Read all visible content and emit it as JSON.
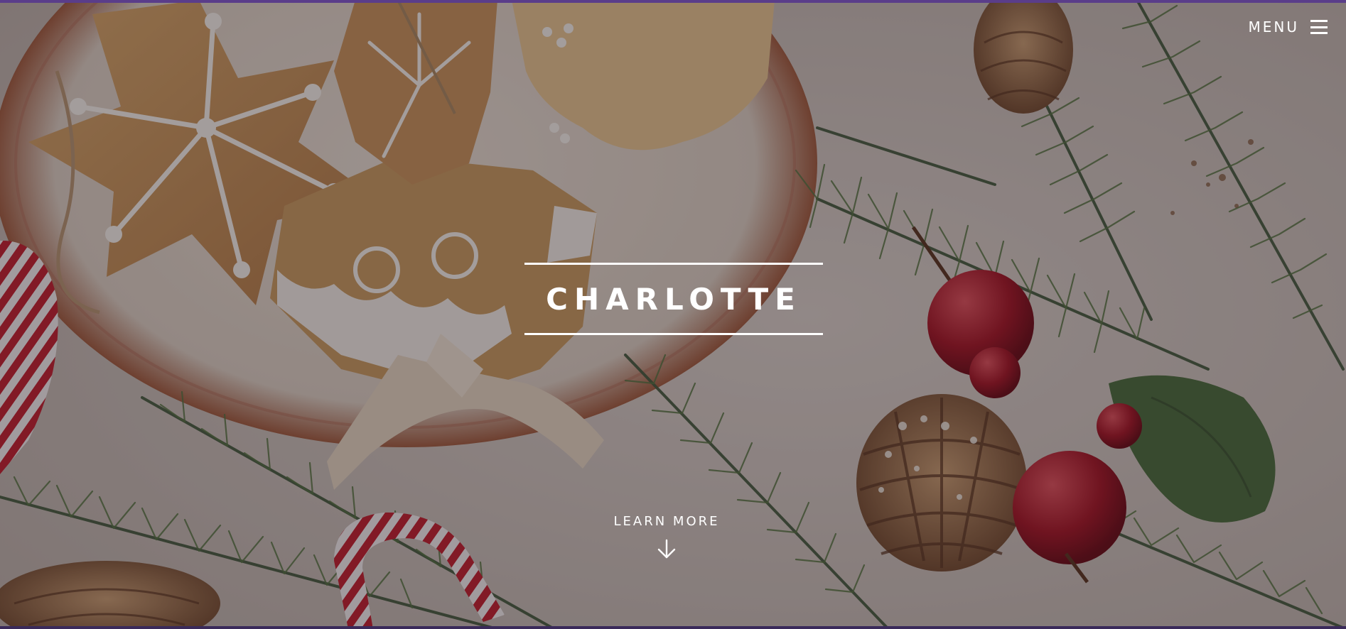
{
  "header": {
    "menu_label": "MENU"
  },
  "hero": {
    "title": "CHARLOTTE",
    "cta_label": "LEARN MORE",
    "icons": {
      "menu": "hamburger-icon",
      "cta": "arrow-down-icon"
    }
  },
  "colors": {
    "accent_border": "#5a3d8a",
    "text": "#ffffff"
  }
}
